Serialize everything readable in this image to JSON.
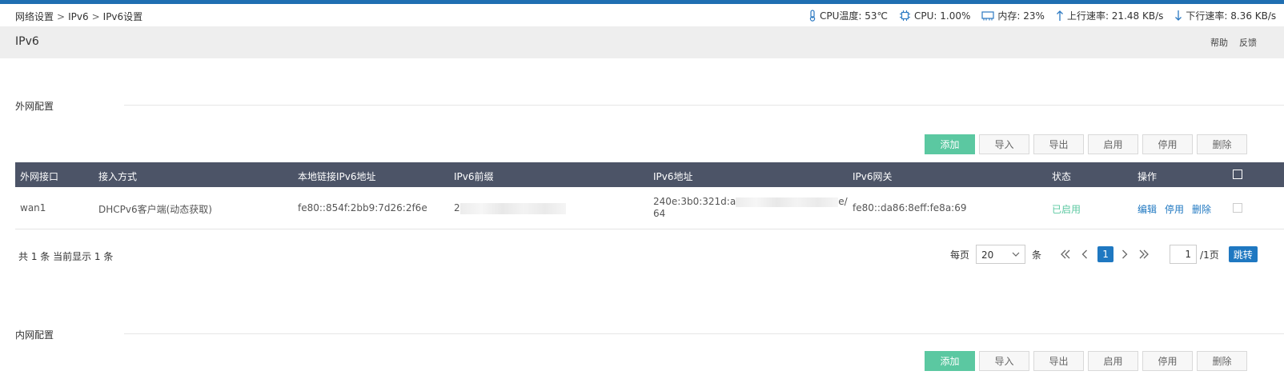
{
  "breadcrumb": {
    "items": [
      "网络设置",
      "IPv6",
      "IPv6设置"
    ],
    "separator": ">"
  },
  "status": {
    "cpu_temp": "CPU温度: 53℃",
    "cpu": "CPU: 1.00%",
    "memory": "内存: 23%",
    "upload": "上行速率: 21.48 KB/s",
    "download": "下行速率: 8.36 KB/s"
  },
  "page": {
    "title": "IPv6",
    "help": "帮助",
    "feedback": "反馈"
  },
  "wan": {
    "title": "外网配置",
    "buttons": {
      "add": "添加",
      "import": "导入",
      "export": "导出",
      "enable": "启用",
      "disable": "停用",
      "delete": "删除"
    },
    "columns": [
      "外网接口",
      "接入方式",
      "本地链接IPv6地址",
      "IPv6前缀",
      "IPv6地址",
      "IPv6网关",
      "状态",
      "操作"
    ],
    "rows": [
      {
        "interface": "wan1",
        "access": "DHCPv6客户端(动态获取)",
        "link_local": "fe80::854f:2bb9:7d26:2f6e",
        "prefix_visible": "2",
        "address_line1": "240e:3b0:321d:a",
        "address_line1_tail": "e/",
        "address_line2": "64",
        "gateway": "fe80::da86:8eff:fe8a:69",
        "status": "已启用",
        "ops": {
          "edit": "编辑",
          "disable": "停用",
          "delete": "删除"
        }
      }
    ],
    "pager": {
      "summary": "共 1 条 当前显示 1 条",
      "per_page_label": "每页",
      "per_page_value": "20",
      "unit": "条",
      "current_page": "1",
      "page_input": "1",
      "total_pages": "/1页",
      "go": "跳转"
    }
  },
  "lan": {
    "title": "内网配置",
    "buttons": {
      "add": "添加",
      "import": "导入",
      "export": "导出",
      "enable": "启用",
      "disable": "停用",
      "delete": "删除"
    }
  },
  "colors": {
    "accent": "#1f78c1",
    "primary_button": "#5bc8a1",
    "table_header": "#4c5467",
    "top_strip": "#1f6fb2"
  }
}
